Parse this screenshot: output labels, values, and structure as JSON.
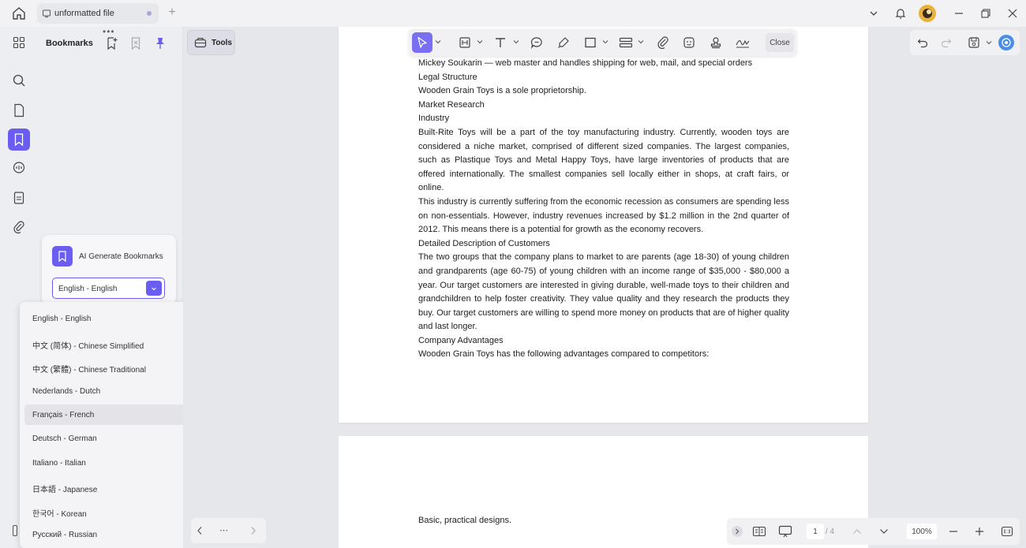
{
  "titlebar": {
    "tab_title": "unformatted file"
  },
  "panel": {
    "title": "Bookmarks"
  },
  "ai_card": {
    "label": "AI Generate Bookmarks",
    "selected_language": "English - English"
  },
  "languages": [
    "English - English",
    "中文 (简体) - Chinese Simplified",
    "中文 (繁體) - Chinese Traditional",
    "Nederlands - Dutch",
    "Français - French",
    "Deutsch - German",
    "Italiano - Italian",
    "日本語 - Japanese",
    "한국어 - Korean",
    "Русский - Russian"
  ],
  "tools": {
    "label": "Tools"
  },
  "toolbar": {
    "close_label": "Close"
  },
  "document": {
    "page1": [
      "Mickey Soukarin — web master and handles shipping for web, mail, and special orders",
      "Legal Structure",
      "Wooden Grain Toys is a sole proprietorship.",
      "Market Research",
      "Industry",
      "Built-Rite Toys will be a part of the toy manufacturing industry. Currently, wooden toys are considered a niche market, comprised of different sized companies. The largest companies, such as Plastique Toys and Metal Happy Toys, have large inventories of products that are offered internationally. The smallest companies sell locally either in shops, at craft fairs, or online.",
      "This industry is currently suffering from the economic recession as consumers are spending less on non-essentials. However, industry revenues increased by $1.2 million in the 2nd quarter of 2012. This means there is a potential for growth as the economy recovers.",
      "Detailed Description of Customers",
      "The two groups that the company plans to market to are parents (age 18-30) of young children and grandparents (age 60-75) of young children with an income range of $35,000 - $80,000 a year. Our target customers are interested in giving durable, well-made toys to their children and grandchildren to help foster creativity. They value quality and they research the products they buy. Our target customers are willing to spend more money on products that are of higher quality and last longer.",
      "Company Advantages",
      "Wooden Grain Toys has the following advantages compared to competitors:"
    ],
    "page2": [
      "Basic, practical designs."
    ]
  },
  "pager": {
    "current_page": "1",
    "total_pages": "/ 4",
    "zoom": "100%"
  }
}
